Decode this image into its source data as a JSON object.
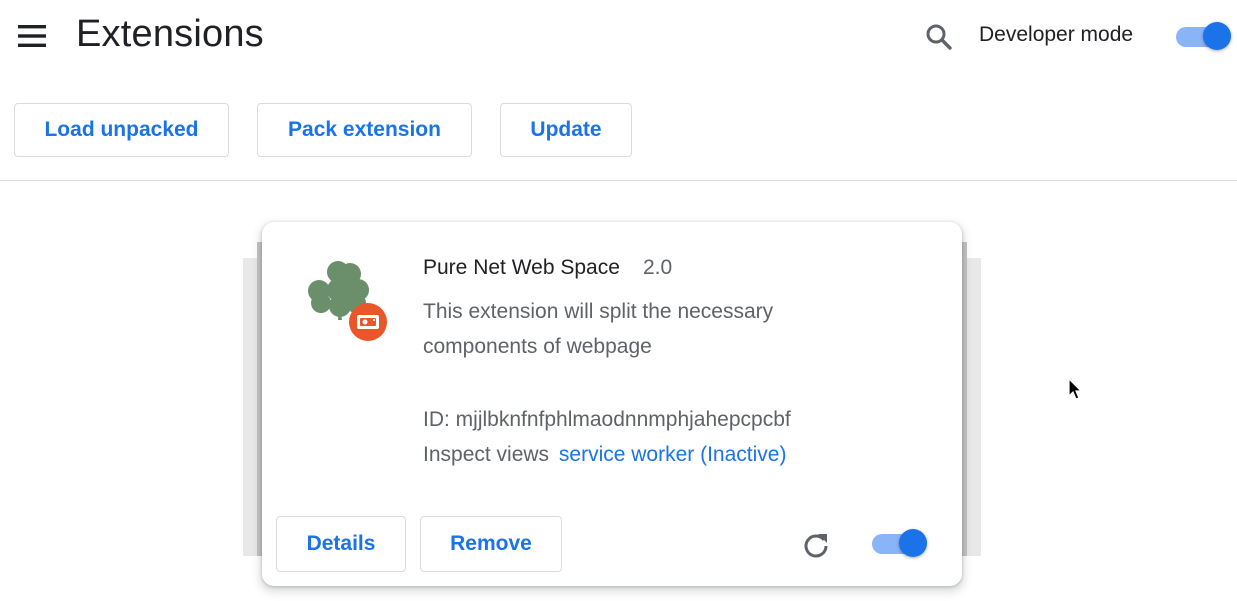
{
  "header": {
    "title": "Extensions",
    "menu_icon": "hamburger-menu-icon",
    "search_icon": "search-icon",
    "developer_mode_label": "Developer mode",
    "developer_mode_on": true
  },
  "toolbar": {
    "load_unpacked_label": "Load unpacked",
    "pack_extension_label": "Pack extension",
    "update_label": "Update"
  },
  "extension": {
    "name": "Pure Net Web Space",
    "version": "2.0",
    "description": "This extension will split the necessary components of webpage",
    "id_text": "ID: mjjlbknfnfphlmaodnnmphjahepcpcbf",
    "inspect_label": "Inspect views",
    "inspect_link": "service worker (Inactive)",
    "details_label": "Details",
    "remove_label": "Remove",
    "enabled": true,
    "icon": "clover-icon",
    "badge_icon": "unpacked-badge-icon",
    "reload_icon": "reload-icon"
  },
  "colors": {
    "accent": "#1a73e8",
    "toggle_track": "#8ab4f8",
    "clover": "#6b8e6b",
    "badge": "#e8562a"
  }
}
